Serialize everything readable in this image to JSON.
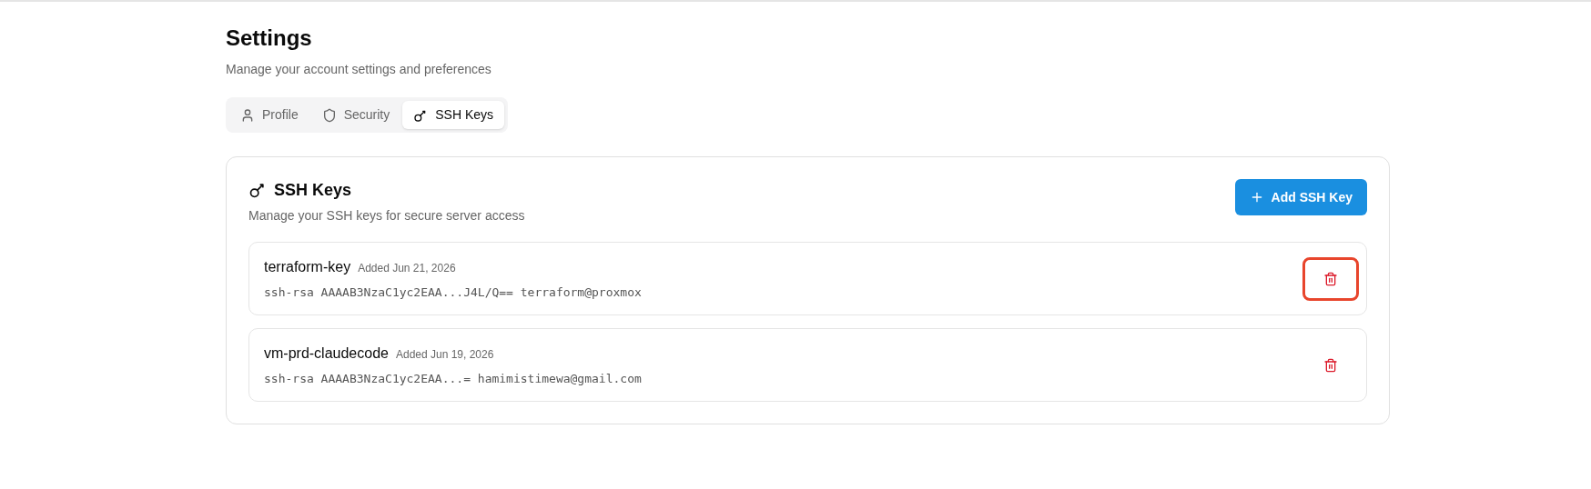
{
  "page": {
    "title": "Settings",
    "subtitle": "Manage your account settings and preferences"
  },
  "tabs": [
    {
      "label": "Profile",
      "selected": false
    },
    {
      "label": "Security",
      "selected": false
    },
    {
      "label": "SSH Keys",
      "selected": true
    }
  ],
  "card": {
    "title": "SSH Keys",
    "description": "Manage your SSH keys for secure server access",
    "add_button": "Add SSH Key"
  },
  "keys": [
    {
      "name": "terraform-key",
      "added": "Added Jun 21, 2026",
      "fingerprint": "ssh-rsa AAAAB3NzaC1yc2EAA...J4L/Q== terraform@proxmox",
      "highlighted": true
    },
    {
      "name": "vm-prd-claudecode",
      "added": "Added Jun 19, 2026",
      "fingerprint": "ssh-rsa AAAAB3NzaC1yc2EAA...= hamimistimewa@gmail.com",
      "highlighted": false
    }
  ]
}
